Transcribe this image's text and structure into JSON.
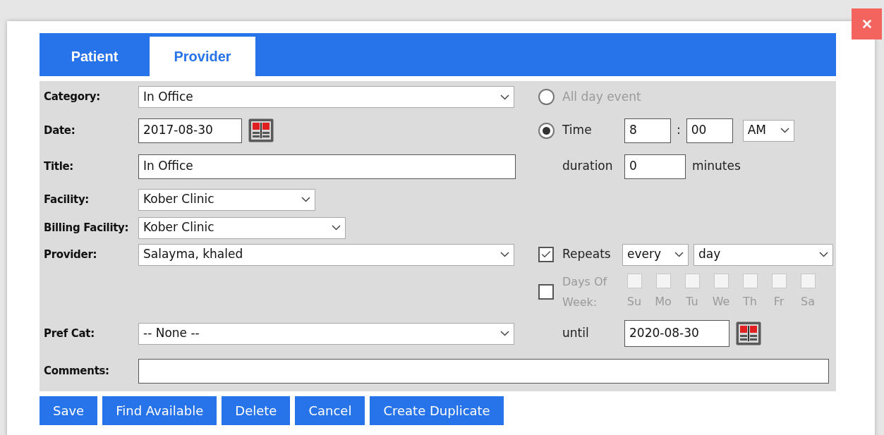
{
  "tabs": [
    {
      "label": "Patient",
      "selected": false
    },
    {
      "label": "Provider",
      "selected": true
    }
  ],
  "fields": [
    {
      "label": "Category:",
      "kind": "select",
      "value": "In Office"
    },
    {
      "label": "Date:",
      "kind": "date",
      "value": "2017-08-30"
    },
    {
      "label": "Title:",
      "kind": "text",
      "value": "In Office"
    },
    {
      "label": "Facility:",
      "kind": "select",
      "value": "Kober Clinic"
    },
    {
      "label": "Billing Facility:",
      "kind": "select",
      "value": "Kober Clinic"
    },
    {
      "label": "Provider:",
      "kind": "select",
      "value": "Salayma, khaled"
    },
    {
      "label": "Pref Cat:",
      "kind": "select",
      "value": "-- None --"
    },
    {
      "label": "Comments:",
      "kind": "text"
    }
  ],
  "all_day": {
    "label": "All day event",
    "selected": false,
    "disabled": true
  },
  "time": {
    "label": "Time",
    "selected": true,
    "hour": "8",
    "separator": ":",
    "minute": "00",
    "meridiem": "AM"
  },
  "duration": {
    "label": "duration",
    "value": "0",
    "unit": "minutes"
  },
  "repeats": {
    "label": "Repeats",
    "checked": true,
    "frequency": "every",
    "unit": "day"
  },
  "days_of_week": {
    "label": "Days Of Week:",
    "checked": false,
    "disabled": true,
    "days": [
      {
        "label": "Su",
        "checked": false
      },
      {
        "label": "Mo",
        "checked": false
      },
      {
        "label": "Tu",
        "checked": false
      },
      {
        "label": "We",
        "checked": false
      },
      {
        "label": "Th",
        "checked": false
      },
      {
        "label": "Fr",
        "checked": false
      },
      {
        "label": "Sa",
        "checked": false
      }
    ]
  },
  "until": {
    "label": "until",
    "value": "2020-08-30"
  },
  "buttons": [
    "Save",
    "Find Available",
    "Delete",
    "Cancel",
    "Create Duplicate"
  ]
}
